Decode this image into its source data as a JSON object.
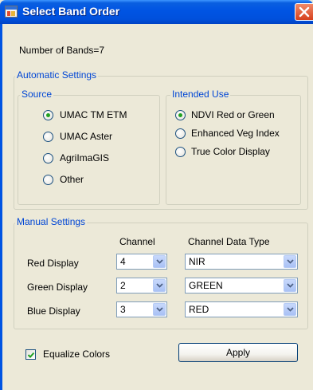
{
  "window": {
    "title": "Select Band Order",
    "title_icon": "app-window-icon",
    "close_icon": "close-icon"
  },
  "num_bands_label": "Number of Bands=7",
  "automatic": {
    "title": "Automatic Settings",
    "source": {
      "title": "Source",
      "options": [
        {
          "label": "UMAC TM ETM",
          "selected": true
        },
        {
          "label": "UMAC Aster",
          "selected": false
        },
        {
          "label": "AgriImaGIS",
          "selected": false
        },
        {
          "label": "Other",
          "selected": false
        }
      ]
    },
    "intended_use": {
      "title": "Intended Use",
      "options": [
        {
          "label": "NDVI Red or Green",
          "selected": true
        },
        {
          "label": "Enhanced Veg Index",
          "selected": false
        },
        {
          "label": "True Color Display",
          "selected": false
        }
      ]
    }
  },
  "manual": {
    "title": "Manual Settings",
    "col_channel": "Channel",
    "col_data_type": "Channel Data Type",
    "rows": [
      {
        "label": "Red Display",
        "channel": "4",
        "data_type": "NIR"
      },
      {
        "label": "Green Display",
        "channel": "2",
        "data_type": "GREEN"
      },
      {
        "label": "Blue Display",
        "channel": "3",
        "data_type": "RED"
      }
    ]
  },
  "equalize": {
    "label": "Equalize Colors",
    "checked": true
  },
  "apply_label": "Apply",
  "colors": {
    "title_bar": "#0054e3",
    "group_title": "#0046d5",
    "face": "#ece9d8",
    "radio_dot": "#21a121"
  }
}
